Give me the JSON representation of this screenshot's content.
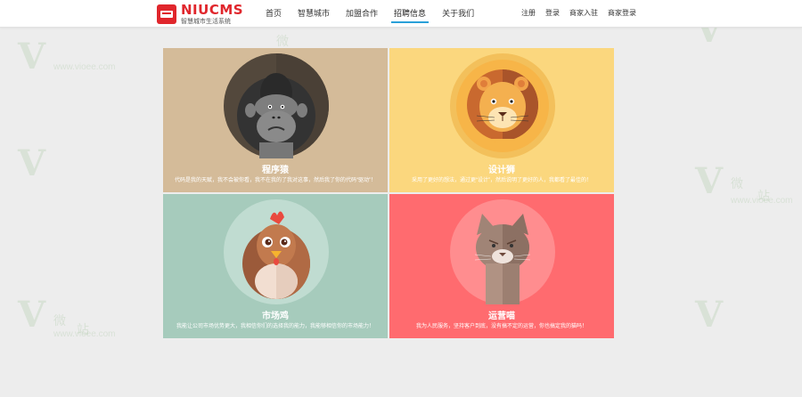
{
  "logo": {
    "main": "NIUCMS",
    "sub": "智慧城市生活系统"
  },
  "nav": {
    "items": [
      {
        "label": "首页",
        "active": false
      },
      {
        "label": "智慧城市",
        "active": false
      },
      {
        "label": "加盟合作",
        "active": false
      },
      {
        "label": "招聘信息",
        "active": true
      },
      {
        "label": "关于我们",
        "active": false
      }
    ]
  },
  "user_nav": {
    "register": "注册",
    "login": "登录",
    "merchant_join": "商家入驻",
    "merchant_login": "商家登录"
  },
  "tiles": [
    {
      "title": "程序猿",
      "desc": "代码是我的天赋，我不会被你看，我不在我的了我对这事，然后我了你的代码“驱动”！",
      "color": "#d4bb99"
    },
    {
      "title": "设计狮",
      "desc": "采用了更好的想法，通过更“设计”，然后说明了更好的人，我都看了最佳的！",
      "color": "#fbd77e"
    },
    {
      "title": "市场鸡",
      "desc": "我能让公司市场优势更大，我相信你们的选择我的能力，我能够相信你的市场能力！",
      "color": "#a6cbbc"
    },
    {
      "title": "运营喵",
      "desc": "我为人民服务，坚持客户到底，没有搞不定的运营，你也搞定我的猫吗！",
      "color": "#ff6b6f"
    }
  ],
  "watermark": {
    "char1": "微",
    "char2": "e",
    "char3": "站",
    "url": "www.vioee.com",
    "logo_letter": "V"
  }
}
